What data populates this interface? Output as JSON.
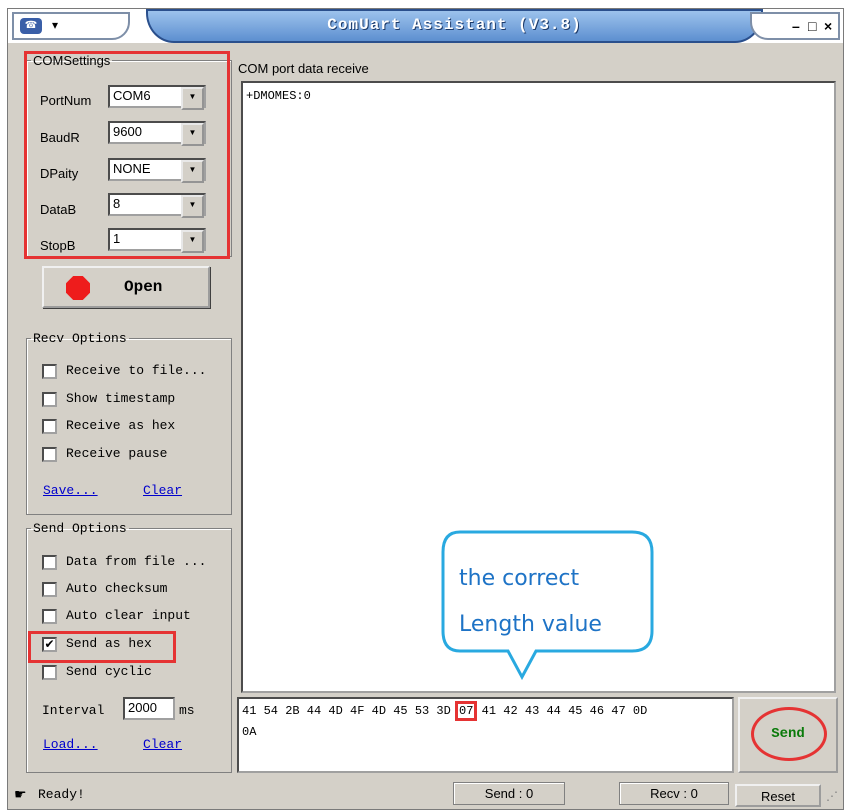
{
  "window": {
    "title": "ComUart Assistant (V3.8)",
    "minimize": "–",
    "maximize": "□",
    "close": "×"
  },
  "com_settings": {
    "legend": "COMSettings",
    "fields": [
      {
        "label": "PortNum",
        "value": "COM6"
      },
      {
        "label": "BaudR",
        "value": "9600"
      },
      {
        "label": "DPaity",
        "value": "NONE"
      },
      {
        "label": "DataB",
        "value": "8"
      },
      {
        "label": "StopB",
        "value": "1"
      }
    ]
  },
  "open_button": {
    "label": "Open"
  },
  "recv_options": {
    "legend": "Recv Options",
    "items": [
      {
        "label": "Receive to file...",
        "checked": false
      },
      {
        "label": "Show timestamp",
        "checked": false
      },
      {
        "label": "Receive as hex",
        "checked": false
      },
      {
        "label": "Receive pause",
        "checked": false
      }
    ],
    "save_label": "Save...",
    "clear_label": "Clear"
  },
  "send_options": {
    "legend": "Send Options",
    "items": [
      {
        "label": "Data from file ...",
        "checked": false
      },
      {
        "label": "Auto checksum",
        "checked": false
      },
      {
        "label": "Auto clear input",
        "checked": false
      },
      {
        "label": "Send as hex",
        "checked": true
      },
      {
        "label": "Send cyclic",
        "checked": false
      }
    ],
    "interval_label": "Interval",
    "interval_value": "2000",
    "interval_unit": "ms",
    "load_label": "Load...",
    "clear_label": "Clear"
  },
  "receive": {
    "legend": "COM port data receive",
    "text": "+DMOMES:0"
  },
  "send_input": {
    "line1_before": "41 54 2B 44 4D 4F 4D 45 53 3D",
    "highlight": "07",
    "line1_after": "41 42 43 44 45 46 47 0D",
    "line2": "0A"
  },
  "send_button": {
    "label": "Send"
  },
  "annotation": {
    "line1": "the correct",
    "line2": "Length value"
  },
  "status": {
    "ready": "Ready!",
    "send": "Send : 0",
    "recv": "Recv : 0",
    "reset": "Reset"
  },
  "colors": {
    "highlight_red": "#e53333",
    "callout_blue": "#29a9e0",
    "send_green": "#0a7a0a"
  }
}
